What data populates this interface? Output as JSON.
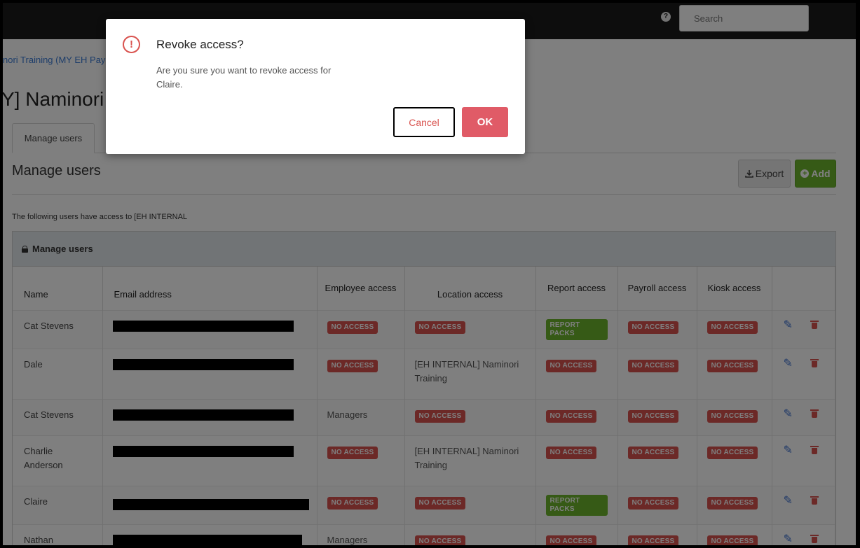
{
  "header": {
    "help_icon": "?",
    "search_placeholder": "Search"
  },
  "breadcrumb": "nori Training (MY EH Pay",
  "page_title": "Y] Naminori T",
  "tabs": [
    {
      "label": "Manage users"
    }
  ],
  "section": {
    "title": "Manage users",
    "export_label": "Export",
    "add_label": "Add",
    "intro": "The following users have access to [EH INTERNAL"
  },
  "panel": {
    "title": "Manage users",
    "columns": [
      "Name",
      "Email address",
      "Employee access",
      "Location access",
      "Report access",
      "Payroll access",
      "Kiosk access"
    ],
    "rows": [
      {
        "name": "Cat Stevens",
        "employee": "NO ACCESS",
        "location": "NO ACCESS",
        "report": "REPORT PACKS",
        "payroll": "NO ACCESS",
        "kiosk": "NO ACCESS"
      },
      {
        "name": "Dale",
        "employee": "NO ACCESS",
        "location": "[EH INTERNAL] Naminori Training",
        "report": "NO ACCESS",
        "payroll": "NO ACCESS",
        "kiosk": "NO ACCESS"
      },
      {
        "name": "Cat Stevens",
        "employee": "Managers",
        "location": "NO ACCESS",
        "report": "NO ACCESS",
        "payroll": "NO ACCESS",
        "kiosk": "NO ACCESS"
      },
      {
        "name": "Charlie Anderson",
        "employee": "NO ACCESS",
        "location": "[EH INTERNAL] Naminori Training",
        "report": "NO ACCESS",
        "payroll": "NO ACCESS",
        "kiosk": "NO ACCESS"
      },
      {
        "name": "Claire",
        "employee": "NO ACCESS",
        "location": "NO ACCESS",
        "report": "REPORT PACKS",
        "payroll": "NO ACCESS",
        "kiosk": "NO ACCESS"
      },
      {
        "name": "Nathan",
        "employee": "Managers",
        "location": "NO ACCESS",
        "report": "NO ACCESS",
        "payroll": "NO ACCESS",
        "kiosk": "NO ACCESS"
      }
    ]
  },
  "modal": {
    "icon": "!",
    "title": "Revoke access?",
    "message": "Are you sure you want to revoke access for Claire.",
    "cancel_label": "Cancel",
    "ok_label": "OK"
  },
  "colors": {
    "topbar": "#1a1a1a",
    "danger": "#d9534f",
    "success": "#6cb52d",
    "ok_button": "#e05b67",
    "link": "#3a7bd5"
  },
  "icons": {
    "alert": "exclamation-circle-icon",
    "lock": "lock-icon",
    "edit": "pencil-icon",
    "delete": "trash-icon",
    "export": "download-icon",
    "add": "plus-circle-icon",
    "help": "question-icon"
  }
}
